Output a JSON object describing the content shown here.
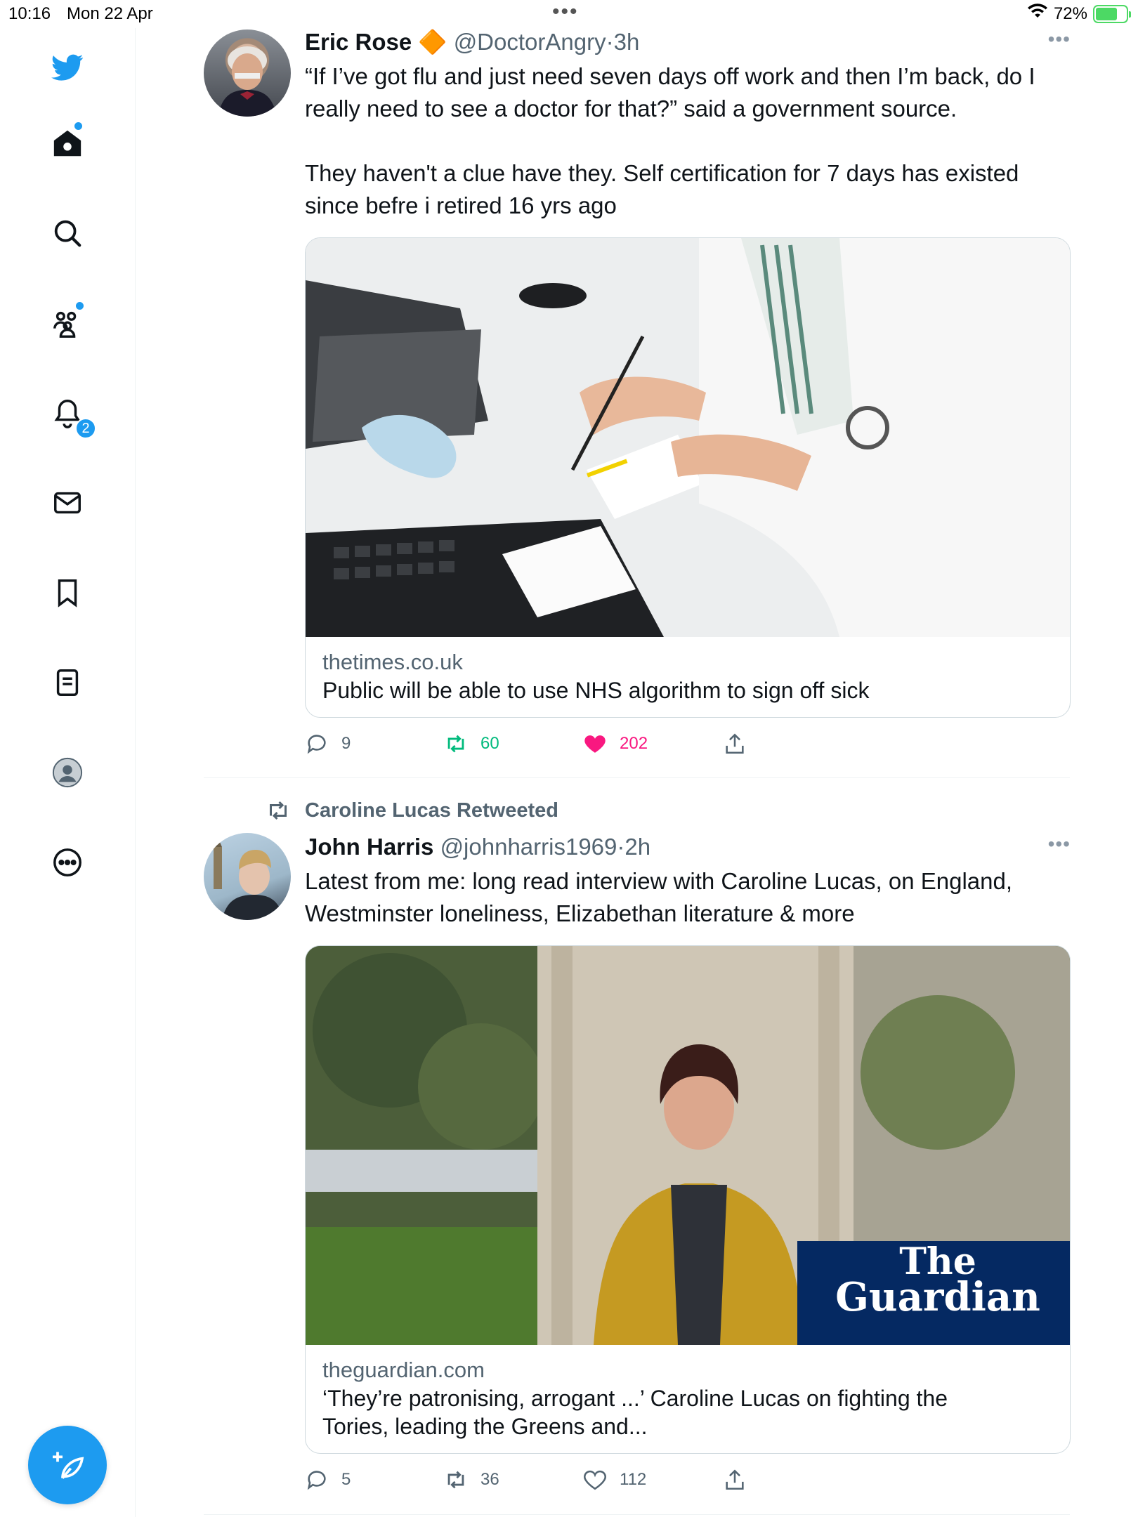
{
  "status_bar": {
    "time": "10:16",
    "date": "Mon 22 Apr",
    "battery": "72%",
    "battery_fraction": 0.72,
    "multitask_dots": "•••"
  },
  "sidebar": {
    "items": [
      {
        "name": "twitter-logo-icon"
      },
      {
        "name": "home-icon"
      },
      {
        "name": "search-icon"
      },
      {
        "name": "communities-icon"
      },
      {
        "name": "notifications-icon"
      },
      {
        "name": "messages-icon"
      },
      {
        "name": "bookmarks-icon"
      },
      {
        "name": "lists-icon"
      },
      {
        "name": "profile-icon"
      },
      {
        "name": "more-icon"
      }
    ],
    "notifications_badge": "2",
    "compose_label": "+"
  },
  "colors": {
    "accent": "#1d9bf0",
    "retweet": "#00ba7c",
    "like": "#f91880",
    "muted": "#536471"
  },
  "tweets": [
    {
      "name": "Eric Rose",
      "verified_badge": "🔶",
      "handle": "@DoctorAngry",
      "sep": "·",
      "time": "3h",
      "more": "•••",
      "text_lines": [
        "“If I’ve got flu and just need seven days off work and then I’m back, do I",
        "really need to see a doctor for that?” said a government source.",
        "",
        "They haven't a clue have they. Self certification for 7 days has existed",
        "since befre i retired 16 yrs ago"
      ],
      "card": {
        "domain": "thetimes.co.uk",
        "title": "Public will be able to use NHS algorithm to sign off sick"
      },
      "replies": "9",
      "retweets": "60",
      "likes": "202",
      "liked": true,
      "retweeted": true
    },
    {
      "retweeted_by": "Caroline Lucas Retweeted",
      "name": "John Harris",
      "handle": "@johnharris1969",
      "sep": "·",
      "time": "2h",
      "more": "•••",
      "text_lines": [
        "Latest from me: long read interview with Caroline Lucas, on England,",
        "Westminster loneliness, Elizabethan literature & more"
      ],
      "card": {
        "domain": "theguardian.com",
        "title_line1": "‘They’re patronising, arrogant ...’ Caroline Lucas on fighting the",
        "title_line2": "Tories, leading the Greens and...",
        "logo_line1": "The",
        "logo_line2": "Guardian"
      },
      "replies": "5",
      "retweets": "36",
      "likes": "112",
      "liked": false,
      "retweeted": false
    }
  ]
}
